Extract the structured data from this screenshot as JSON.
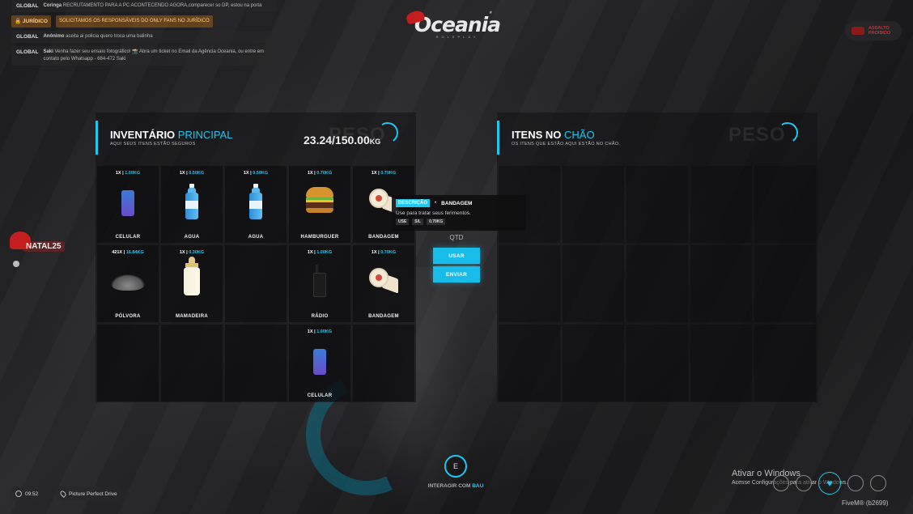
{
  "chat": [
    {
      "channel": "GLOBAL",
      "author": "Coringa",
      "message": "RECRUTAMENTO PARA A PC ACONTECENDO AGORA,comparecer so DP, estou na porta",
      "style": "normal"
    },
    {
      "channel": "JURÍDICO",
      "author": "",
      "message": "SOLICITAMOS OS RESPONSÁVEIS DO ONLY FANS NO JURÍDICO",
      "style": "juridico"
    },
    {
      "channel": "GLOBAL",
      "author": "Anônimo",
      "message": "aceita ai policia quero troca uma balinha",
      "style": "normal"
    },
    {
      "channel": "GLOBAL",
      "author": "Saki",
      "message": "Venha fazer seu ensaio fotográfico! 📸 Abra um ticket no Email da Agência Oceania, ou entre em contato pelo Whatsapp - 684-472 Saki",
      "style": "normal"
    }
  ],
  "logo": {
    "name": "Oceania",
    "sub": "ROLEPLAY"
  },
  "badge": {
    "label": "ASSALTO PROIBIDO",
    "color": "#c23030"
  },
  "natal": {
    "label": "NATAL25"
  },
  "inventory": {
    "title_main": "INVENTÁRIO",
    "title_highlight": "PRINCIPAL",
    "subtitle": "AQUI SEUS ITENS ESTÃO SEGUROS",
    "peso_watermark": "PESO",
    "weight": "23.24/150.00",
    "weight_unit": "KG",
    "slots": [
      {
        "qty": "1X",
        "weight": "1.00",
        "unit": "KG",
        "name": "CELULAR",
        "icon": "phone-icon"
      },
      {
        "qty": "1X",
        "weight": "0.50",
        "unit": "KG",
        "name": "AGUA",
        "icon": "water-bottle-icon"
      },
      {
        "qty": "1X",
        "weight": "0.50",
        "unit": "KG",
        "name": "AGUA",
        "icon": "water-bottle-icon"
      },
      {
        "qty": "1X",
        "weight": "0.70",
        "unit": "KG",
        "name": "HAMBURGUER",
        "icon": "burger-icon"
      },
      {
        "qty": "1X",
        "weight": "0.70",
        "unit": "KG",
        "name": "BANDAGEM",
        "icon": "bandage-icon"
      },
      {
        "qty": "421X",
        "weight": "16.84",
        "unit": "KG",
        "name": "PÓLVORA",
        "icon": "gunpowder-icon"
      },
      {
        "qty": "1X",
        "weight": "0.30",
        "unit": "KG",
        "name": "MAMADEIRA",
        "icon": "baby-bottle-icon"
      },
      {
        "qty": "",
        "weight": "",
        "unit": "",
        "name": "",
        "icon": ""
      },
      {
        "qty": "1X",
        "weight": "1.00",
        "unit": "KG",
        "name": "RÁDIO",
        "icon": "radio-icon"
      },
      {
        "qty": "1X",
        "weight": "0.70",
        "unit": "KG",
        "name": "BANDAGEM",
        "icon": "bandage-icon"
      },
      {
        "qty": "",
        "weight": "",
        "unit": "",
        "name": "",
        "icon": ""
      },
      {
        "qty": "",
        "weight": "",
        "unit": "",
        "name": "",
        "icon": ""
      },
      {
        "qty": "",
        "weight": "",
        "unit": "",
        "name": "",
        "icon": ""
      },
      {
        "qty": "1X",
        "weight": "1.00",
        "unit": "KG",
        "name": "CELULAR",
        "icon": "phone-icon"
      },
      {
        "qty": "",
        "weight": "",
        "unit": "",
        "name": "",
        "icon": ""
      }
    ]
  },
  "ground": {
    "title_main": "ITENS NO",
    "title_highlight": "CHÃO",
    "subtitle": "OS ITENS QUE ESTÃO AQUI ESTÃO NO CHÃO.",
    "peso_watermark": "PESO"
  },
  "tooltip": {
    "badge": "DESCRIÇÃO",
    "separator": "•",
    "name": "BANDAGEM",
    "description": "Use para tratar seus ferimentos.",
    "tags": [
      "USE",
      "S/L",
      "0.70KG"
    ]
  },
  "actions": {
    "qtd_label": "QTD",
    "use_label": "USAR",
    "send_label": "ENVIAR"
  },
  "interact": {
    "key": "E",
    "text": "INTERAGIR COM",
    "highlight": "BAU"
  },
  "hud": {
    "time": "09:52",
    "location": "Picture Perfect Drive"
  },
  "windows": {
    "title": "Ativar o Windows",
    "subtitle": "Acesse Configurações para ativar o Windows."
  },
  "fivem": {
    "label": "FiveM® (b2699)"
  },
  "colors": {
    "accent": "#1ec8f0",
    "juridico": "#e68214"
  }
}
